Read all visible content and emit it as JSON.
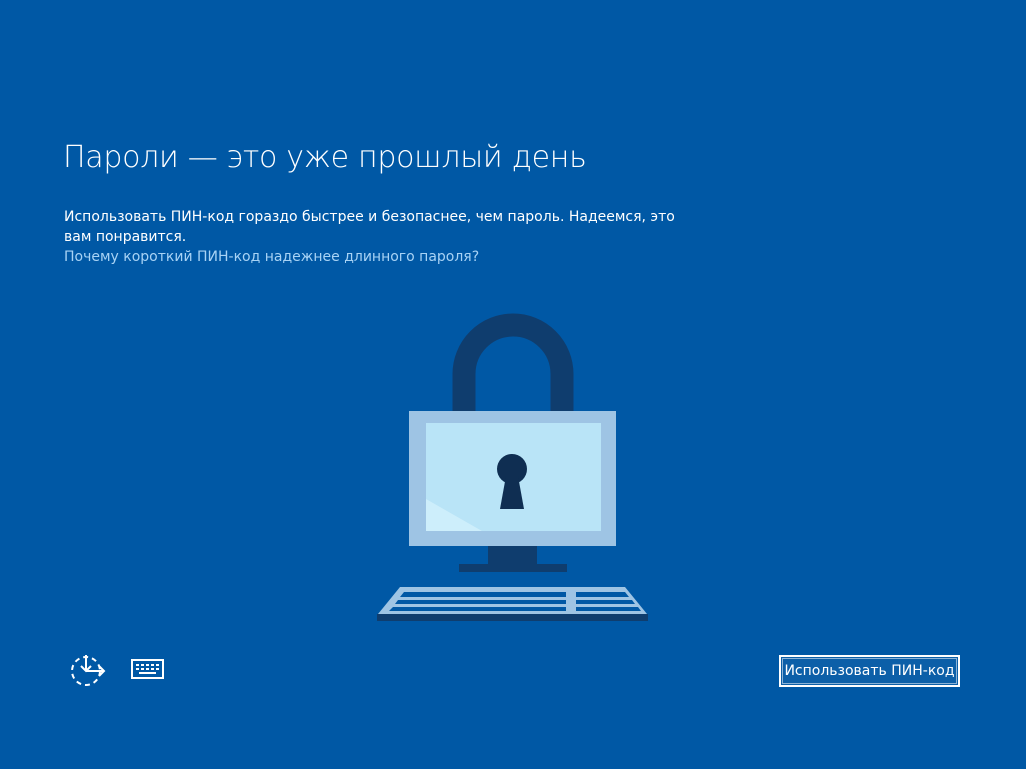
{
  "page": {
    "title": "Пароли — это уже прошлый день",
    "description": "Использовать ПИН-код гораздо быстрее и безопаснее, чем пароль. Надеемся, это вам понравится.",
    "help_link": "Почему короткий ПИН-код надежнее длинного пароля?"
  },
  "illustration": {
    "icon": "lock-computer-icon",
    "colors": {
      "shackle": "#0f3d6e",
      "monitor_frame": "#9ec4e4",
      "screen": "#b9e4f7",
      "keyhole": "#0f2e52",
      "keyboard": "#9ec4e4"
    }
  },
  "bottom_bar": {
    "ease_of_access_icon": "ease-of-access-icon",
    "keyboard_icon": "keyboard-icon",
    "primary_button_label": "Использовать ПИН-код"
  },
  "colors": {
    "background": "#0058a5",
    "link": "#a8d3f5",
    "text": "#ffffff"
  }
}
